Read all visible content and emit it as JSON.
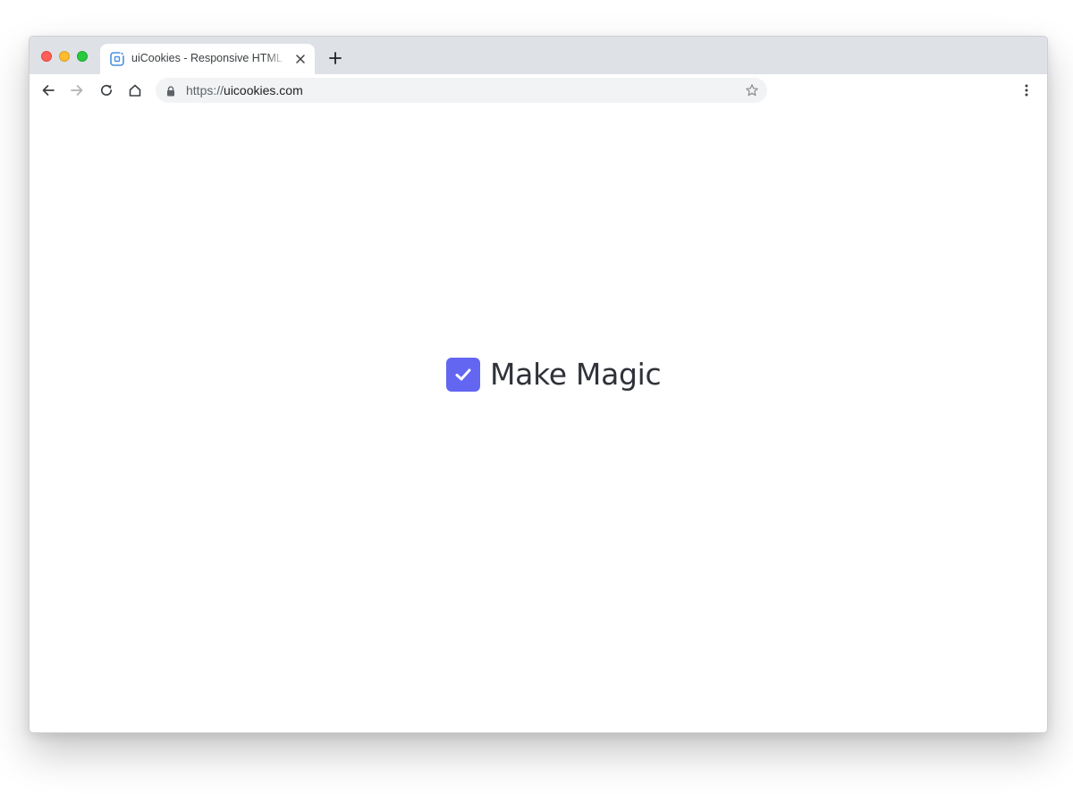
{
  "browser": {
    "tab": {
      "title": "uiCookies - Responsive HTML Templates"
    },
    "address_bar": {
      "scheme": "https://",
      "host": "uicookies.com"
    },
    "icons": {
      "window_controls": [
        "close-dot",
        "minimize-dot",
        "maximize-dot"
      ],
      "tab_favicon": "uicookies-favicon-icon",
      "tab_close": "close-icon",
      "new_tab": "plus-icon",
      "nav": [
        "back-arrow-icon",
        "forward-arrow-icon",
        "reload-icon",
        "home-icon"
      ],
      "security": "lock-icon",
      "bookmark": "star-icon",
      "menu": "kebab-menu-icon"
    },
    "colors": {
      "tabstrip": "#dee1e6",
      "omnibox": "#f1f3f4",
      "close_dot": "#ff5f57",
      "minimize_dot": "#febc2e",
      "maximize_dot": "#28c840"
    }
  },
  "page": {
    "checkbox": {
      "label": "Make Magic",
      "checked": true,
      "color": "#6366f1"
    }
  }
}
